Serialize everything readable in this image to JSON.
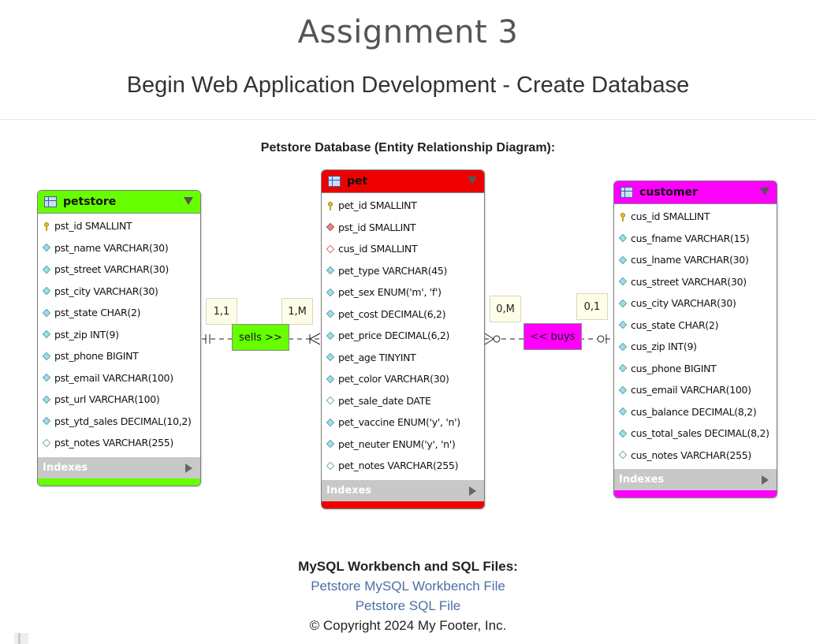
{
  "header": {
    "title": "Assignment 3",
    "subtitle": "Begin Web Application Development - Create Database"
  },
  "diagram": {
    "heading": "Petstore Database (Entity Relationship Diagram):",
    "indexes_label": "Indexes",
    "tables": {
      "petstore": {
        "name": "petstore",
        "color": "#66ff00",
        "columns": [
          {
            "text": "pst_id SMALLINT",
            "icon": "primary-key"
          },
          {
            "text": "pst_name VARCHAR(30)",
            "icon": "column"
          },
          {
            "text": "pst_street VARCHAR(30)",
            "icon": "column"
          },
          {
            "text": "pst_city VARCHAR(30)",
            "icon": "column"
          },
          {
            "text": "pst_state CHAR(2)",
            "icon": "column"
          },
          {
            "text": "pst_zip INT(9)",
            "icon": "column"
          },
          {
            "text": "pst_phone BIGINT",
            "icon": "column"
          },
          {
            "text": "pst_email VARCHAR(100)",
            "icon": "column"
          },
          {
            "text": "pst_url VARCHAR(100)",
            "icon": "column"
          },
          {
            "text": "pst_ytd_sales DECIMAL(10,2)",
            "icon": "column"
          },
          {
            "text": "pst_notes VARCHAR(255)",
            "icon": "nullable-column"
          }
        ]
      },
      "pet": {
        "name": "pet",
        "color": "#ee0000",
        "columns": [
          {
            "text": "pet_id SMALLINT",
            "icon": "primary-key"
          },
          {
            "text": "pst_id SMALLINT",
            "icon": "foreign-key"
          },
          {
            "text": "cus_id SMALLINT",
            "icon": "nullable-foreign-key"
          },
          {
            "text": "pet_type VARCHAR(45)",
            "icon": "column"
          },
          {
            "text": "pet_sex ENUM('m', 'f')",
            "icon": "column"
          },
          {
            "text": "pet_cost DECIMAL(6,2)",
            "icon": "column"
          },
          {
            "text": "pet_price DECIMAL(6,2)",
            "icon": "column"
          },
          {
            "text": "pet_age TINYINT",
            "icon": "column"
          },
          {
            "text": "pet_color VARCHAR(30)",
            "icon": "column"
          },
          {
            "text": "pet_sale_date DATE",
            "icon": "nullable-column"
          },
          {
            "text": "pet_vaccine ENUM('y', 'n')",
            "icon": "column"
          },
          {
            "text": "pet_neuter ENUM('y', 'n')",
            "icon": "column"
          },
          {
            "text": "pet_notes VARCHAR(255)",
            "icon": "nullable-column"
          }
        ]
      },
      "customer": {
        "name": "customer",
        "color": "#ff00ff",
        "columns": [
          {
            "text": "cus_id SMALLINT",
            "icon": "primary-key"
          },
          {
            "text": "cus_fname VARCHAR(15)",
            "icon": "column"
          },
          {
            "text": "cus_lname VARCHAR(30)",
            "icon": "column"
          },
          {
            "text": "cus_street VARCHAR(30)",
            "icon": "column"
          },
          {
            "text": "cus_city VARCHAR(30)",
            "icon": "column"
          },
          {
            "text": "cus_state CHAR(2)",
            "icon": "column"
          },
          {
            "text": "cus_zip INT(9)",
            "icon": "column"
          },
          {
            "text": "cus_phone BIGINT",
            "icon": "column"
          },
          {
            "text": "cus_email VARCHAR(100)",
            "icon": "column"
          },
          {
            "text": "cus_balance DECIMAL(8,2)",
            "icon": "column"
          },
          {
            "text": "cus_total_sales DECIMAL(8,2)",
            "icon": "column"
          },
          {
            "text": "cus_notes VARCHAR(255)",
            "icon": "nullable-column"
          }
        ]
      }
    },
    "relationships": {
      "sells": {
        "label": "sells >>",
        "color": "#66ff00",
        "card_left": "1,1",
        "card_right": "1,M"
      },
      "buys": {
        "label": "<< buys",
        "color": "#ff00ff",
        "card_left": "0,M",
        "card_right": "0,1"
      }
    }
  },
  "files": {
    "heading": "MySQL Workbench and SQL Files:",
    "workbench_link": "Petstore MySQL Workbench File",
    "sql_link": "Petstore SQL File"
  },
  "footer": {
    "copyright": "© Copyright 2024 My Footer, Inc."
  }
}
